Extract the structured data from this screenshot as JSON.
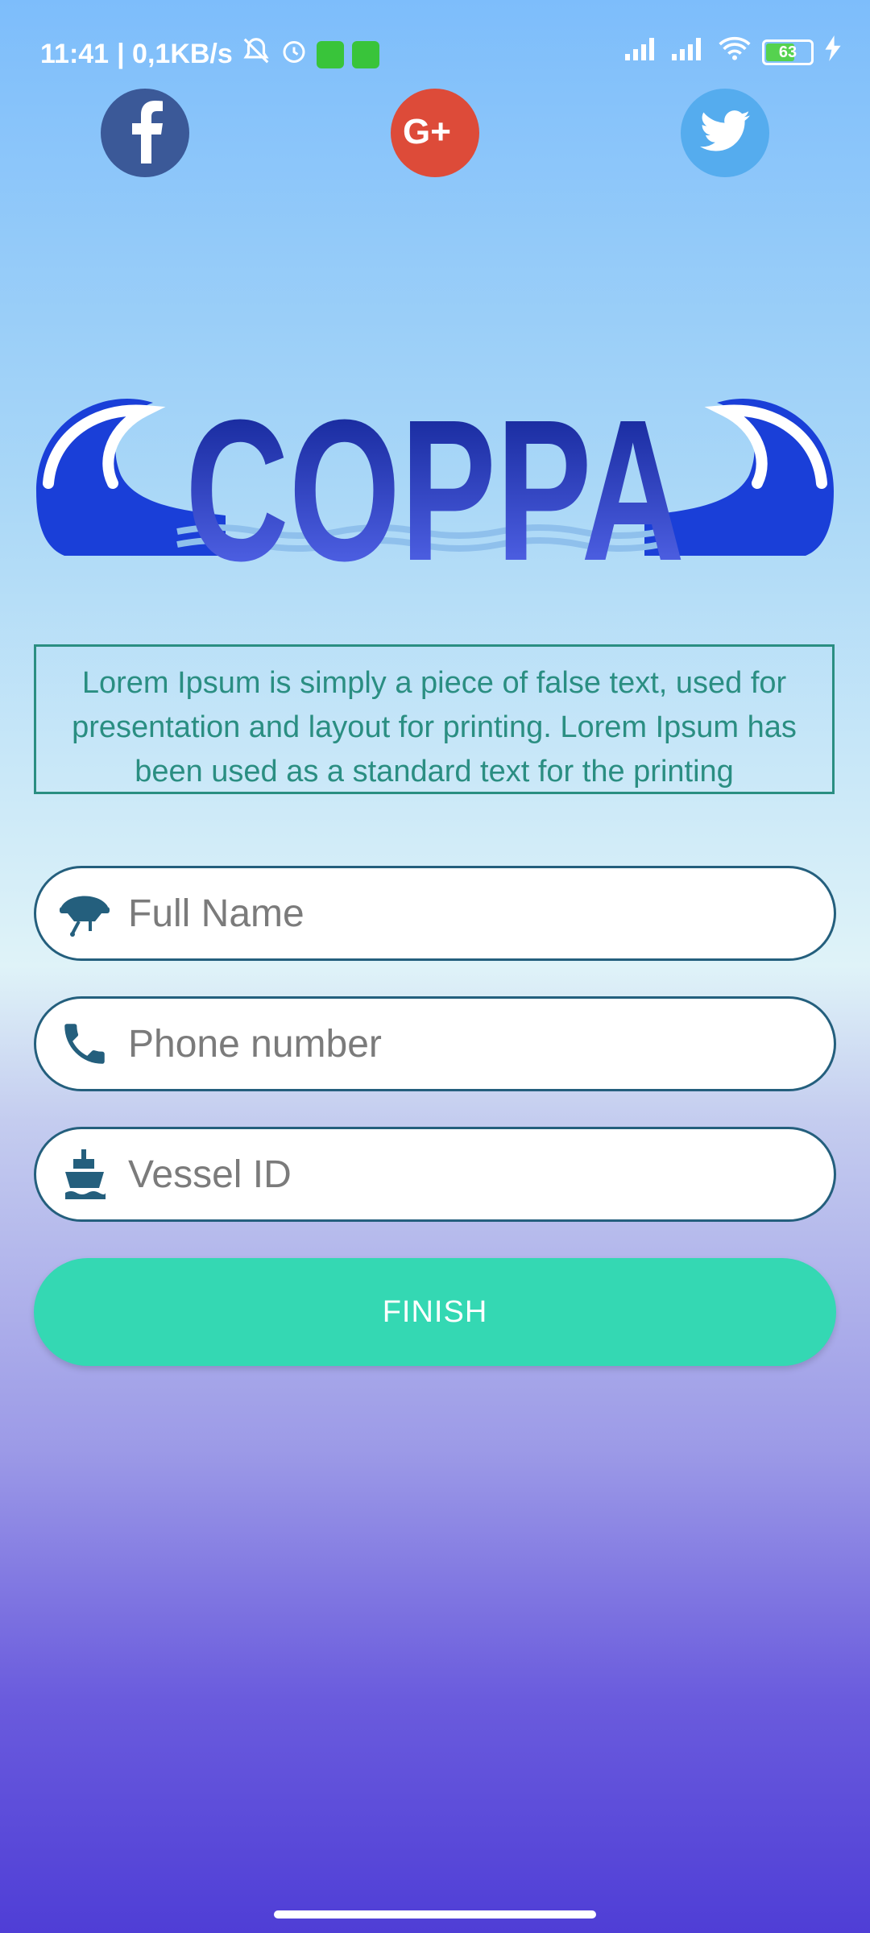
{
  "status_bar": {
    "time": "11:41",
    "speed": "| 0,1KB/s",
    "battery": "63"
  },
  "social": {
    "facebook": "facebook-icon",
    "google_plus": "google-plus-icon",
    "twitter": "twitter-icon"
  },
  "logo": {
    "text": "COPPA"
  },
  "info": {
    "text": "Lorem Ipsum is simply a piece of false text, used for presentation and layout for printing. Lorem Ipsum has been used as a standard text for the printing"
  },
  "form": {
    "full_name_placeholder": "Full Name",
    "phone_placeholder": "Phone number",
    "vessel_placeholder": "Vessel ID",
    "finish_label": "FINISH"
  },
  "colors": {
    "accent": "#34d8b3",
    "border": "#245f7d",
    "text_teal": "#2a8e82"
  }
}
